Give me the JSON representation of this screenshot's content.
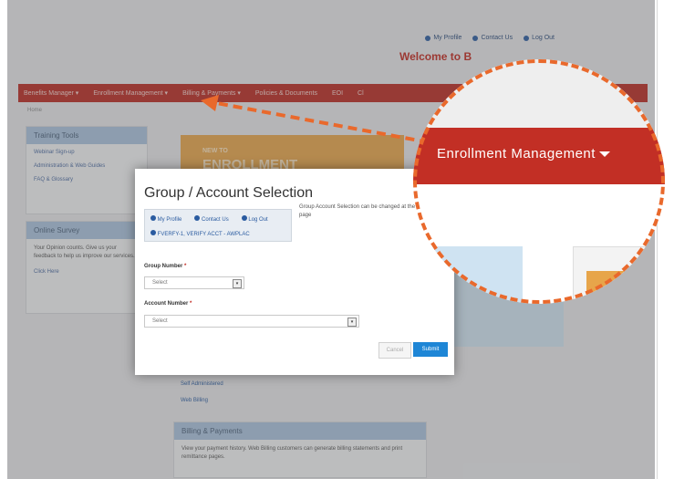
{
  "top_links": {
    "my_profile": "My Profile",
    "contact_us": "Contact Us",
    "log_out": "Log Out"
  },
  "welcome": "Welcome to B",
  "nav": {
    "items": [
      "Benefits Manager ▾",
      "Enrollment Management ▾",
      "Billing & Payments ▾",
      "Policies & Documents",
      "EOI",
      "Cl"
    ]
  },
  "breadcrumb": "Home",
  "training": {
    "title": "Training Tools",
    "links": [
      "Webinar Sign-up",
      "Administration & Web Guides",
      "FAQ & Glossary"
    ]
  },
  "survey": {
    "title": "Online Survey",
    "text": "Your Opinion counts. Give us your feedback to help us improve our services.",
    "link": "Click Here"
  },
  "promo": {
    "line1": "NEW TO",
    "line2": "ENROLLMENT MANAGEMENT?"
  },
  "modal": {
    "title": "Group / Account Selection",
    "links": {
      "my_profile": "My Profile",
      "contact_us": "Contact Us",
      "log_out": "Log Out",
      "verify": "FVERFY-1, VERIFY ACCT - AWPLAC"
    },
    "note": "Group Account Selection can be changed at the top of the page",
    "group_label": "Group Number",
    "group_value": "Select",
    "account_label": "Account Number",
    "account_value": "Select",
    "cancel": "Cancel",
    "submit": "Submit"
  },
  "below_links": [
    "Self Administered",
    "Web Billing"
  ],
  "billing": {
    "title": "Billing & Payments",
    "text": "View your payment history. Web Billing customers can generate billing statements and print remittance pages."
  },
  "zoom": {
    "label": "Enrollment Management"
  },
  "colors": {
    "nav_red": "#b82a22",
    "accent_orange": "#e9692c",
    "submit_blue": "#1e86d6"
  }
}
